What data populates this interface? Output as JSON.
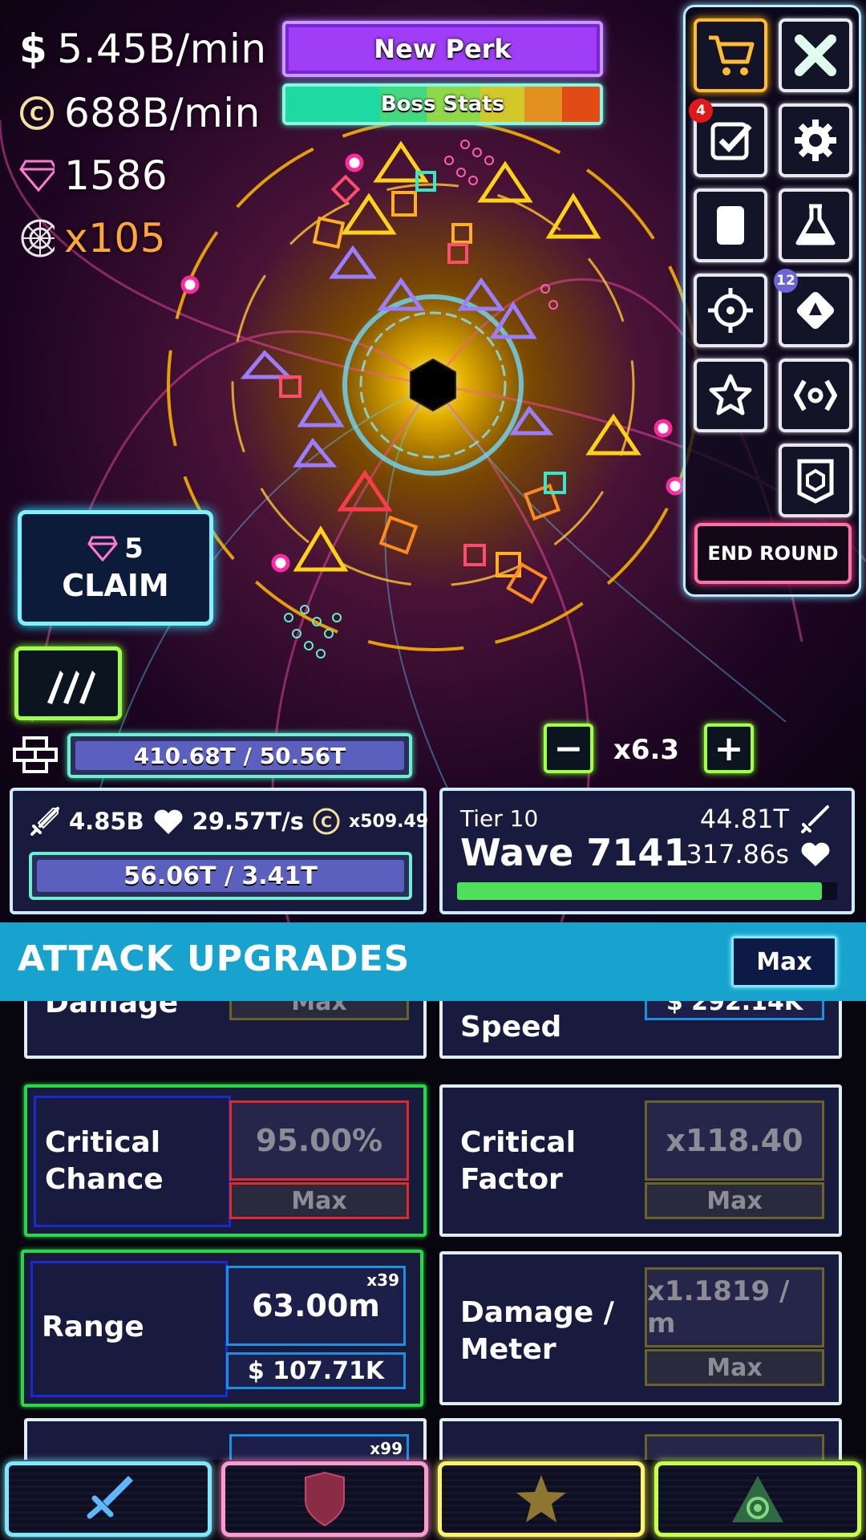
{
  "resources": {
    "cash_per_min": "5.45B/min",
    "cash_symbol": "$",
    "coins_per_min": "688B/min",
    "gems": "1586",
    "multiplier": "x105"
  },
  "top_bar": {
    "perk_label": "New Perk",
    "boss_label": "Boss Stats"
  },
  "menu": {
    "missions_badge": "4",
    "modules_badge": "12",
    "end_round_label": "END ROUND"
  },
  "claim": {
    "gem_amount": "5",
    "label": "CLAIM"
  },
  "wall": {
    "text": "410.68T / 50.56T",
    "fill_fraction": 1.0
  },
  "speed": {
    "minus": "−",
    "value": "x6.3",
    "plus": "+"
  },
  "tower": {
    "damage": "4.85B",
    "regen": "29.57T/s",
    "coin_mult": "x509.49",
    "health_text": "56.06T / 3.41T",
    "health_fill_fraction": 1.0
  },
  "enemy": {
    "tier": "Tier 10",
    "wave": "Wave 7141",
    "damage": "44.81T",
    "time": "317.86s",
    "wave_progress": 0.96
  },
  "upgrades": {
    "title": "ATTACK UPGRADES",
    "max_label": "Max",
    "cards": [
      {
        "name": "Damage",
        "value": "",
        "cost": "Max"
      },
      {
        "name": "Speed",
        "value": "",
        "cost": "$ 292.14K"
      },
      {
        "name": "Critical\nChance",
        "value": "95.00%",
        "cost": "Max"
      },
      {
        "name": "Critical\nFactor",
        "value": "x118.40",
        "cost": "Max"
      },
      {
        "name": "Range",
        "value": "63.00m",
        "cost": "$ 107.71K",
        "level": "x39"
      },
      {
        "name": "Damage /\nMeter",
        "value": "x1.1819 / m",
        "cost": "Max"
      },
      {
        "name": "",
        "value": "",
        "cost": "",
        "level": "x99"
      },
      {
        "name": "",
        "value": "",
        "cost": ""
      }
    ]
  },
  "tabs": [
    {
      "name": "attack",
      "color": "#7fe6ff"
    },
    {
      "name": "defense",
      "color": "#ff9ad0"
    },
    {
      "name": "utility",
      "color": "#fff36a"
    },
    {
      "name": "ultimate",
      "color": "#c8ff4a"
    }
  ],
  "colors": {
    "perk": "#a03ef7",
    "header": "#18a3cf",
    "panel": "#181a3e",
    "shop_border": "#ffbb33",
    "multiplier": "#ffa53a"
  }
}
